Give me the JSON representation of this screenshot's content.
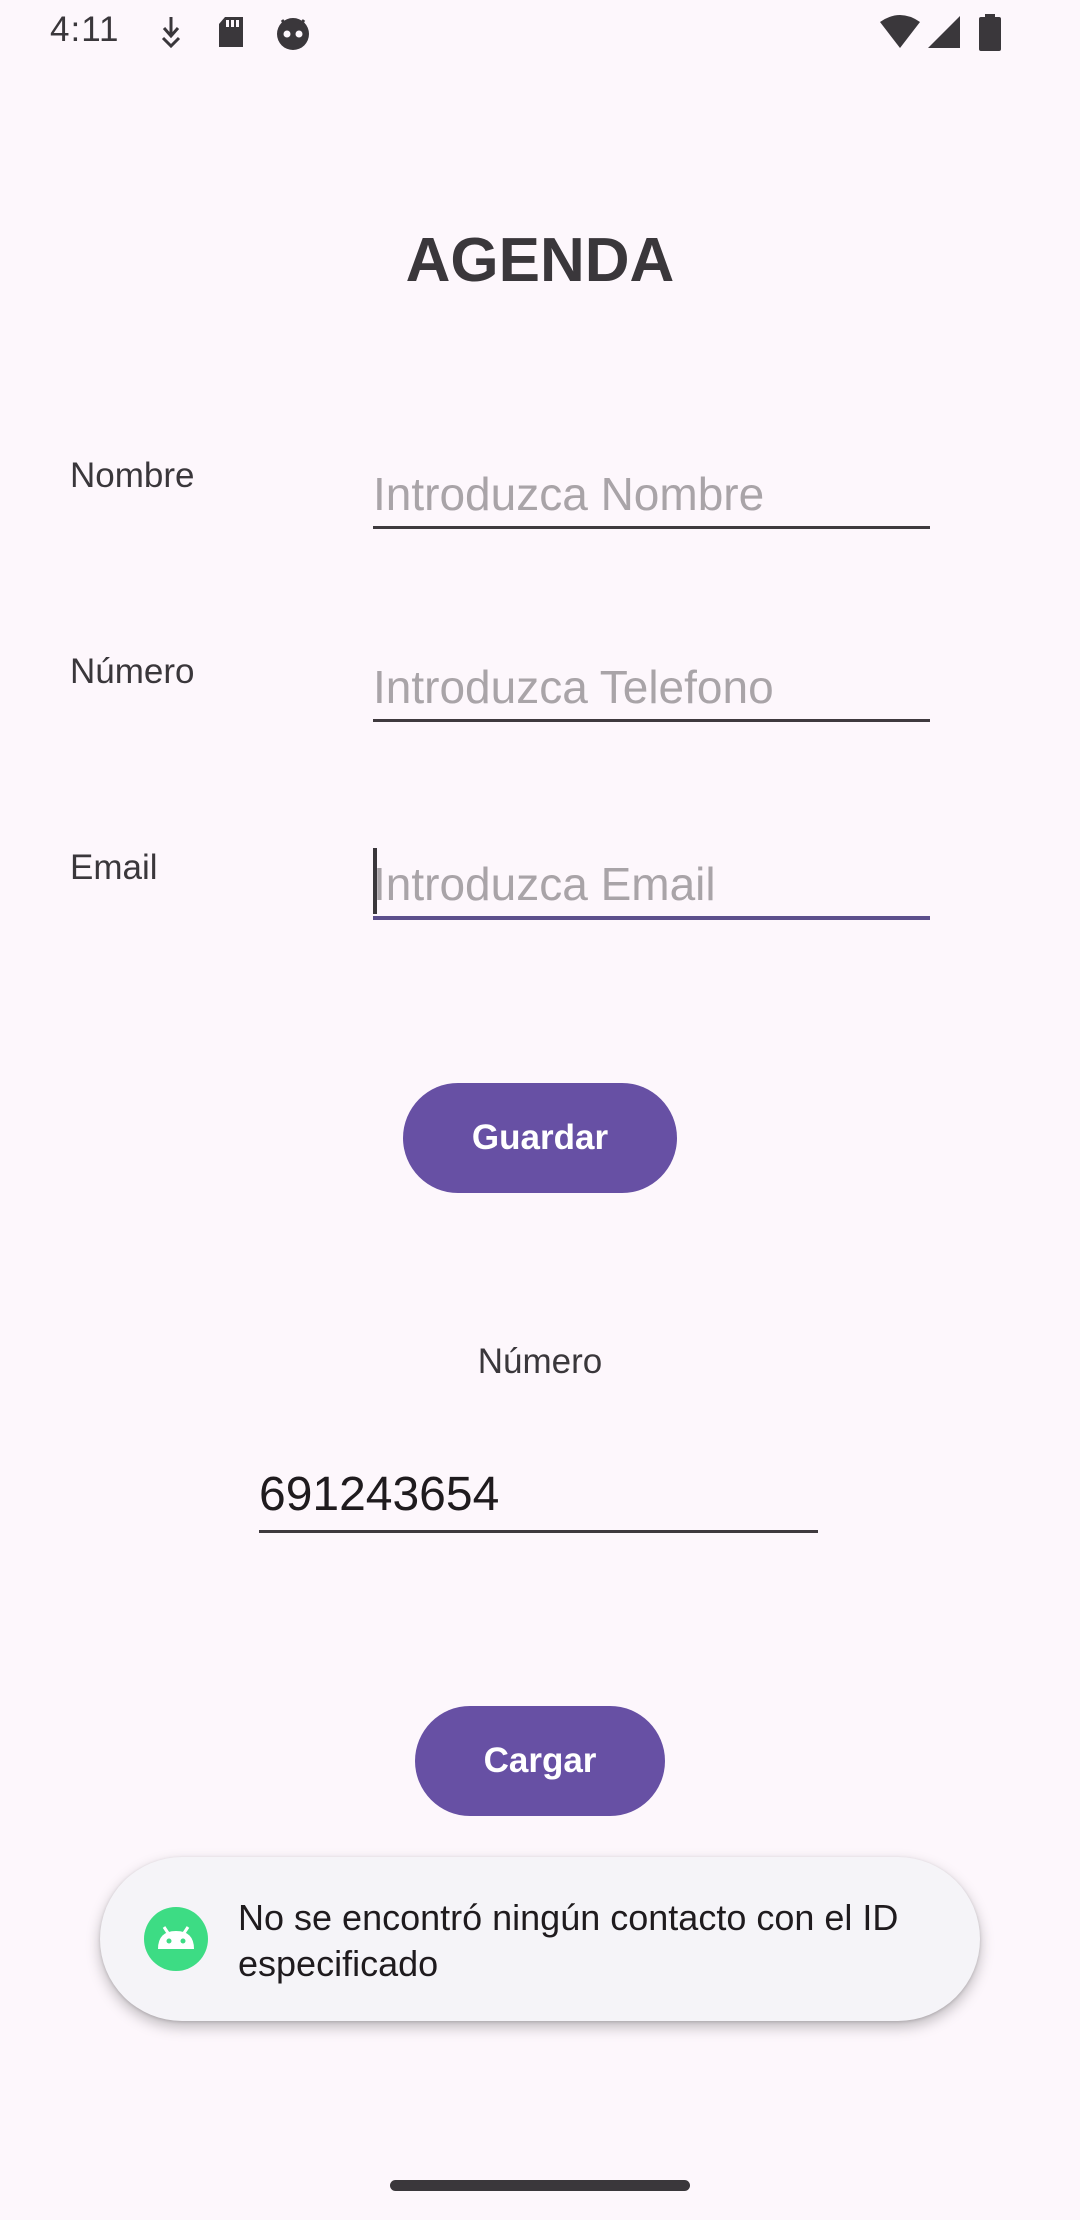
{
  "status_bar": {
    "time": "4:11",
    "left_icons": [
      "usb-debug-icon",
      "sd-card-icon",
      "android-face-icon"
    ],
    "right_icons": [
      "wifi-icon",
      "signal-icon",
      "battery-icon"
    ]
  },
  "title": "AGENDA",
  "form": {
    "name_label": "Nombre",
    "name_placeholder": "Introduzca Nombre",
    "phone_label": "Número",
    "phone_placeholder": "Introduzca Telefono",
    "email_label": "Email",
    "email_placeholder": "Introduzca Email",
    "save_button": "Guardar"
  },
  "lookup": {
    "label": "Número",
    "value": "691243654",
    "load_button": "Cargar"
  },
  "toast": {
    "icon": "android-icon",
    "message": "No se encontró ningún contacto con el ID especificado"
  },
  "colors": {
    "background": "#FDF7FC",
    "accent": "#6750A4",
    "toast_icon": "#3DDC84"
  }
}
